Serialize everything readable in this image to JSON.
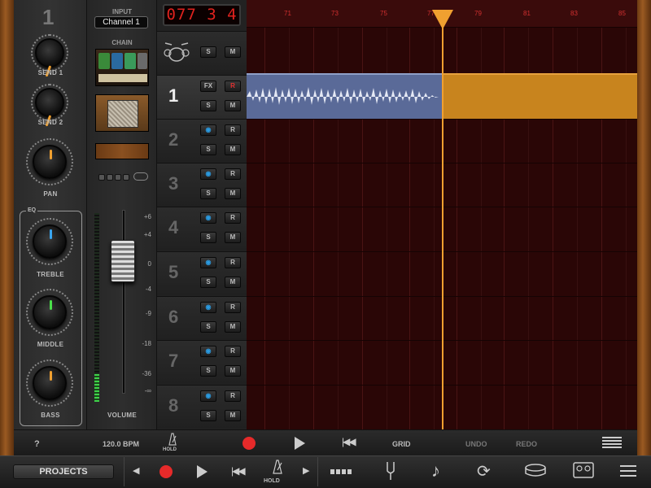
{
  "track_number": "1",
  "strip": {
    "send1_label": "SEND 1",
    "send2_label": "SEND 2",
    "pan_label": "PAN",
    "eq_title": "EQ",
    "treble_label": "TREBLE",
    "middle_label": "MIDDLE",
    "bass_label": "BASS"
  },
  "input": {
    "label": "INPUT",
    "value": "Channel 1"
  },
  "chain": {
    "label": "CHAIN"
  },
  "fader": {
    "label": "VOLUME",
    "scale": [
      "+6",
      "+4",
      "0",
      "-4",
      "-9",
      "-18",
      "-36",
      "-∞"
    ]
  },
  "lcd": "077 3 4",
  "tracks": [
    {
      "number": "1",
      "fx": "FX",
      "rec": "R",
      "solo": "S",
      "mute": "M"
    },
    {
      "number": "2",
      "rec": "R",
      "solo": "S",
      "mute": "M"
    },
    {
      "number": "3",
      "rec": "R",
      "solo": "S",
      "mute": "M"
    },
    {
      "number": "4",
      "rec": "R",
      "solo": "S",
      "mute": "M"
    },
    {
      "number": "5",
      "rec": "R",
      "solo": "S",
      "mute": "M"
    },
    {
      "number": "6",
      "rec": "R",
      "solo": "S",
      "mute": "M"
    },
    {
      "number": "7",
      "rec": "R",
      "solo": "S",
      "mute": "M"
    },
    {
      "number": "8",
      "rec": "R",
      "solo": "S",
      "mute": "M"
    }
  ],
  "drum_track": {
    "solo": "S",
    "mute": "M"
  },
  "ruler": [
    "71",
    "73",
    "75",
    "77",
    "79",
    "81",
    "83",
    "85"
  ],
  "bar1": {
    "help": "?",
    "bpm": "120.0 BPM",
    "hold": "HOLD",
    "grid": "GRID",
    "undo": "UNDO",
    "redo": "REDO"
  },
  "bar2": {
    "projects": "PROJECTS",
    "hold": "HOLD"
  },
  "icons": {
    "drum": "drum-kit-icon",
    "tuner": "tuning-fork-icon",
    "note": "music-note-icon",
    "loop": "loop-icon",
    "menu": "menu-icon"
  },
  "colors": {
    "record": "#e62a2a",
    "playhead": "#f0a030",
    "audio_region": "#5a6a98",
    "lcd_text": "#e0221e"
  }
}
